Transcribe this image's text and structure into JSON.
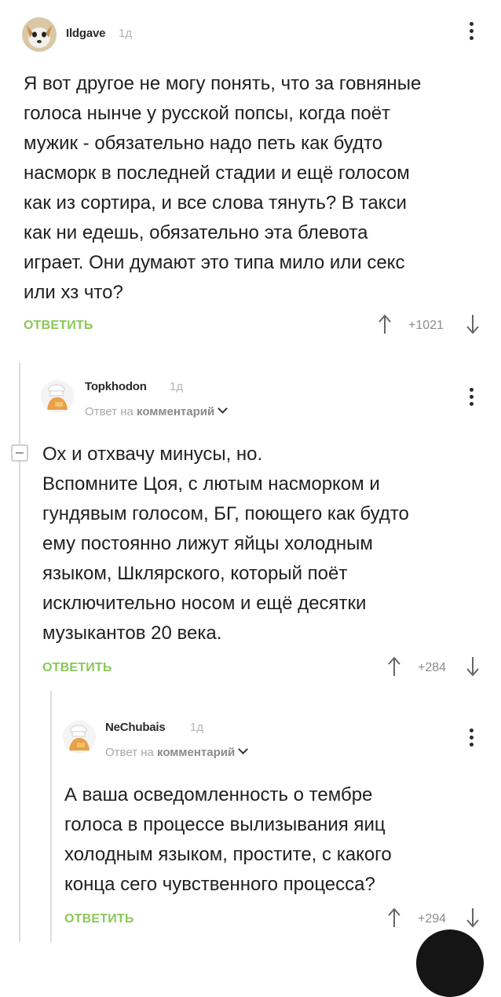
{
  "comments": [
    {
      "username": "Ildgave",
      "time": "1д",
      "lines": [
        "Я вот другое не могу понять, что за говняные",
        "голоса нынче у русской попсы, когда поёт",
        "мужик - обязательно надо петь как будто",
        "насморк в последней стадии и ещё голосом",
        "как из сортира, и все слова тянуть? В такси",
        "как ни едешь, обязательно эта блевота",
        "играет. Они думают это типа мило или секс",
        "или хз что?"
      ],
      "reply_label": "ОТВЕТИТЬ",
      "rating": "+1021"
    },
    {
      "username": "Topkhodon",
      "time": "1д",
      "reply_prefix": "Ответ на",
      "reply_target": "комментарий",
      "lines": [
        "Ох и отхвачу минусы, но.",
        "Вспомните Цоя, с лютым насморком и",
        "гундявым голосом, БГ, поющего как будто",
        "ему постоянно лижут яйцы холодным",
        "языком, Шклярского, который поёт",
        "исключительно носом и ещё десятки",
        "музыкантов 20 века."
      ],
      "reply_label": "ОТВЕТИТЬ",
      "rating": "+284"
    },
    {
      "username": "NeChubais",
      "time": "1д",
      "reply_prefix": "Ответ на",
      "reply_target": "комментарий",
      "lines": [
        "А ваша осведомленность о тембре",
        "голоса в процессе вылизывания яиц",
        "холодным языком, простите, с какого",
        "конца сего чувственного процесса?"
      ],
      "reply_label": "ОТВЕТИТЬ",
      "rating": "+294"
    }
  ],
  "colors": {
    "reply_green": "#8ac858",
    "meta_gray": "#a8a8a8",
    "thread_line": "#dcdcdc"
  },
  "icons": [
    "more-vertical-icon",
    "arrow-up-icon",
    "arrow-down-icon",
    "collapse-icon",
    "dog-avatar",
    "cook-avatar"
  ]
}
